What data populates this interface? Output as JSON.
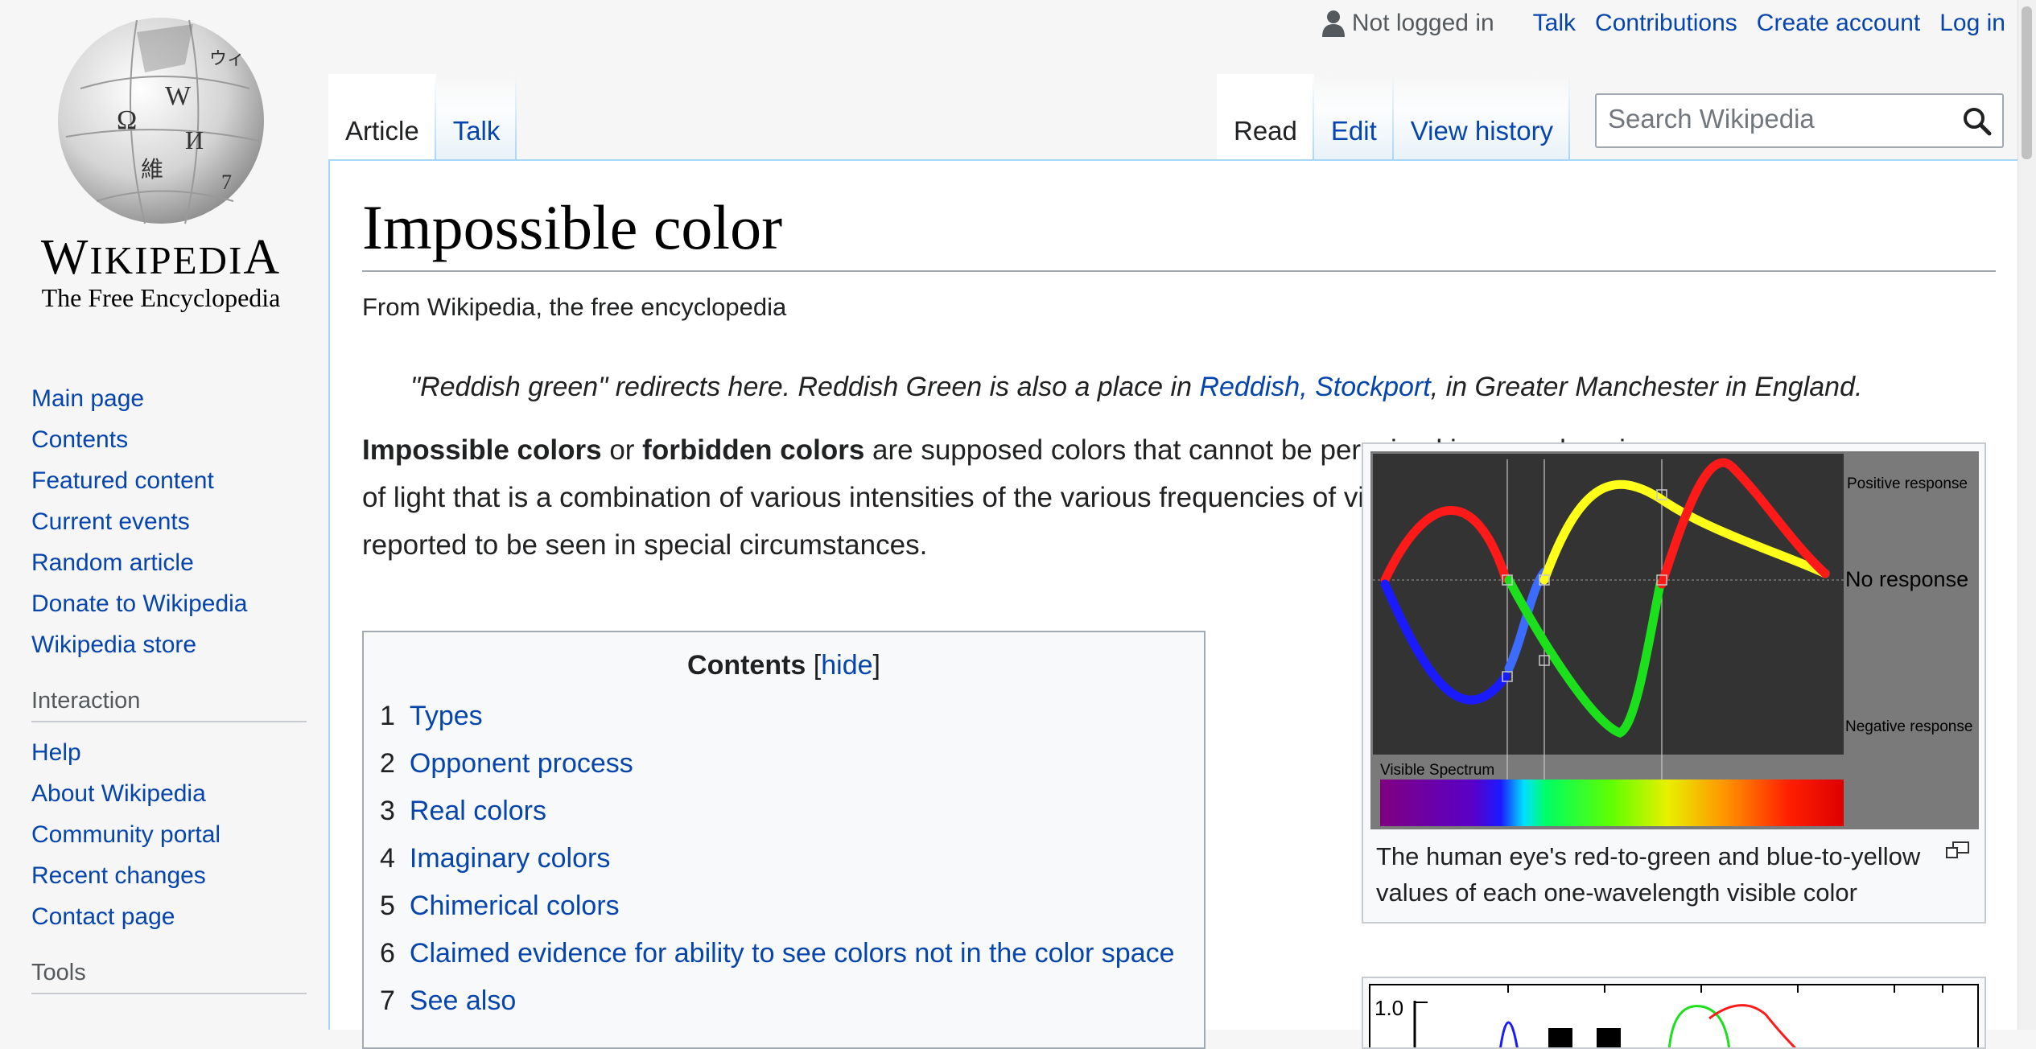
{
  "logo": {
    "wordmark_big": "W",
    "wordmark_rest": "IKIPEDI",
    "wordmark_big2": "A",
    "tagline": "The Free Encyclopedia"
  },
  "sidebar": {
    "nav": [
      "Main page",
      "Contents",
      "Featured content",
      "Current events",
      "Random article",
      "Donate to Wikipedia",
      "Wikipedia store"
    ],
    "interaction_heading": "Interaction",
    "interaction": [
      "Help",
      "About Wikipedia",
      "Community portal",
      "Recent changes",
      "Contact page"
    ],
    "tools_heading": "Tools"
  },
  "personal": {
    "not_logged_in": "Not logged in",
    "links": [
      "Talk",
      "Contributions",
      "Create account",
      "Log in"
    ]
  },
  "tabs": {
    "left": [
      "Article",
      "Talk"
    ],
    "right": [
      "Read",
      "Edit",
      "View history"
    ]
  },
  "search": {
    "placeholder": "Search Wikipedia"
  },
  "article": {
    "title": "Impossible color",
    "site_sub": "From Wikipedia, the free encyclopedia",
    "hatnote": {
      "before": "\"Reddish green\" redirects here. Reddish Green is also a place in ",
      "link": "Reddish, Stockport",
      "after": ", in Greater Manchester in England."
    },
    "lead": {
      "bold1": "Impossible colors",
      "or": " or ",
      "bold2": "forbidden colors",
      "rest": " are supposed colors that cannot be perceived in normal seeing of light that is a combination of various intensities of the various frequencies of visible light, but are reported to be seen in special circumstances."
    },
    "toc": {
      "title": "Contents",
      "toggle_open": "[",
      "toggle": "hide",
      "toggle_close": "]",
      "items": [
        {
          "num": "1",
          "label": "Types"
        },
        {
          "num": "2",
          "label": "Opponent process"
        },
        {
          "num": "3",
          "label": "Real colors"
        },
        {
          "num": "4",
          "label": "Imaginary colors"
        },
        {
          "num": "5",
          "label": "Chimerical colors"
        },
        {
          "num": "6",
          "label": "Claimed evidence for ability to see colors not in the color space"
        },
        {
          "num": "7",
          "label": "See also"
        }
      ]
    },
    "figure1": {
      "labels": {
        "positive": "Positive response",
        "no": "No response",
        "negative": "Negative response",
        "spectrum": "Visible Spectrum"
      },
      "caption": "The human eye's red-to-green and blue-to-yellow values of each one-wavelength visible color"
    },
    "figure2": {
      "y_tick": "1.0"
    }
  },
  "colors": {
    "link": "#0645ad",
    "tab_border": "#a7d7f9",
    "plot_bg": "#333333",
    "side_bg": "#7a7a7a"
  }
}
